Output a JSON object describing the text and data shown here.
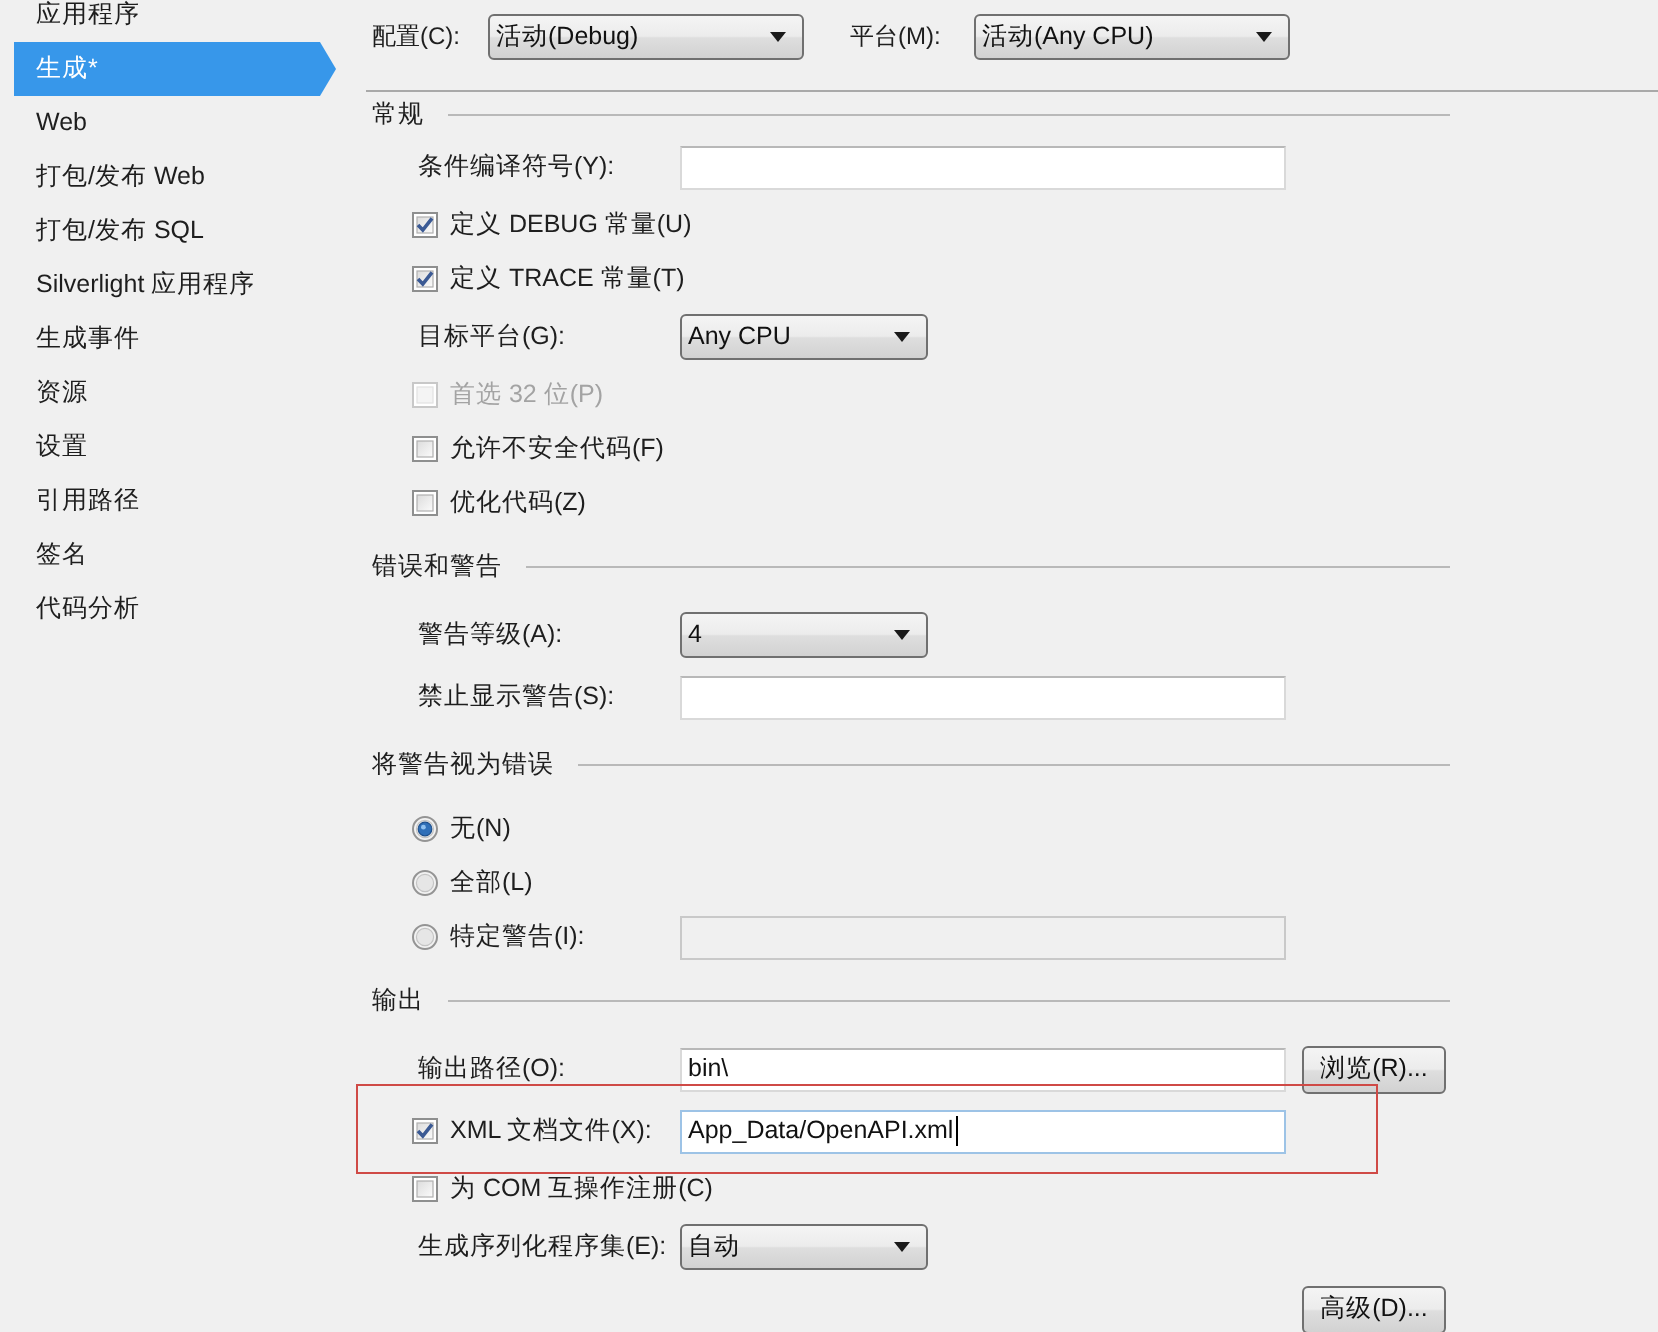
{
  "sidebar": {
    "items": [
      {
        "label": "应用程序",
        "selected": false
      },
      {
        "label": "生成*",
        "selected": true
      },
      {
        "label": "Web",
        "selected": false
      },
      {
        "label": "打包/发布 Web",
        "selected": false
      },
      {
        "label": "打包/发布 SQL",
        "selected": false
      },
      {
        "label": "Silverlight 应用程序",
        "selected": false
      },
      {
        "label": "生成事件",
        "selected": false
      },
      {
        "label": "资源",
        "selected": false
      },
      {
        "label": "设置",
        "selected": false
      },
      {
        "label": "引用路径",
        "selected": false
      },
      {
        "label": "签名",
        "selected": false
      },
      {
        "label": "代码分析",
        "selected": false
      }
    ]
  },
  "toolbar": {
    "fields": [
      {
        "label": "配置(C):",
        "value": "活动(Debug)"
      },
      {
        "label": "平台(M):",
        "value": "活动(Any CPU)"
      }
    ]
  },
  "sections": [
    {
      "title": "常规",
      "rows": [
        {
          "kind": "text",
          "label": "条件编译符号(Y):",
          "disabled": false
        },
        {
          "kind": "checkbox",
          "label": "定义 DEBUG 常量(U)",
          "checked": true,
          "disabled": false
        },
        {
          "kind": "checkbox",
          "label": "定义 TRACE 常量(T)",
          "checked": true,
          "disabled": false
        },
        {
          "kind": "select",
          "label": "目标平台(G):",
          "value": "Any CPU"
        },
        {
          "kind": "checkbox",
          "label": "首选 32 位(P)",
          "checked": false,
          "disabled": true
        },
        {
          "kind": "checkbox",
          "label": "允许不安全代码(F)",
          "checked": false,
          "disabled": false
        },
        {
          "kind": "checkbox",
          "label": "优化代码(Z)",
          "checked": false,
          "disabled": false
        }
      ]
    },
    {
      "title": "错误和警告",
      "rows": [
        {
          "kind": "select",
          "label": "警告等级(A):",
          "value": "4"
        },
        {
          "kind": "text",
          "label": "禁止显示警告(S):",
          "disabled": false
        }
      ]
    },
    {
      "title": "将警告视为错误",
      "rows": [
        {
          "kind": "radio",
          "label": "无(N)",
          "selected": true
        },
        {
          "kind": "radio",
          "label": "全部(L)",
          "selected": false
        },
        {
          "kind": "radio",
          "label": "特定警告(I):",
          "selected": false,
          "field": {
            "disabled": true
          }
        }
      ]
    },
    {
      "title": "输出",
      "rows": [
        {
          "kind": "text",
          "label": "输出路径(O):",
          "value": "bin\\",
          "disabled": false,
          "button": "浏览(R)..."
        },
        {
          "kind": "checkbox",
          "label": "XML 文档文件(X):",
          "checked": true,
          "disabled": false,
          "field": {
            "value": "App_Data/OpenAPI.xml",
            "disabled": false,
            "focused": true
          },
          "highlighted": true
        },
        {
          "kind": "checkbox",
          "label": "为 COM 互操作注册(C)",
          "checked": false,
          "disabled": false
        },
        {
          "kind": "select",
          "label": "生成序列化程序集(E):",
          "value": "自动"
        },
        {
          "kind": "button",
          "label": "高级(D)..."
        }
      ]
    }
  ]
}
